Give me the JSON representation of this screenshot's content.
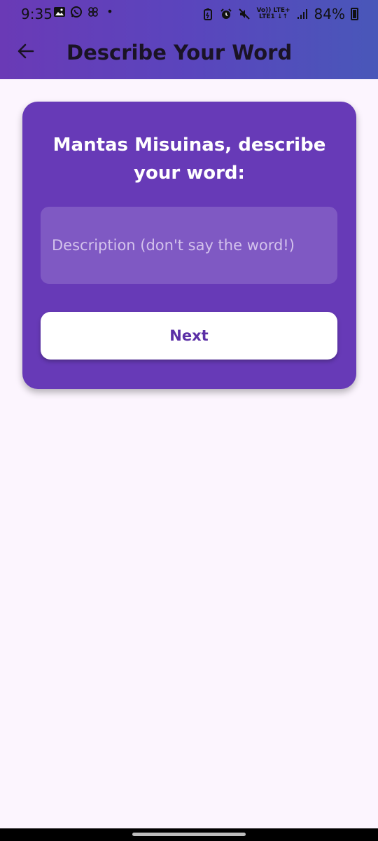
{
  "status_bar": {
    "time": "9:35",
    "dot": "•",
    "network_top": "Vo)) LTE+",
    "network_bottom": "LTE1 ↓↑",
    "battery_percent": "84%"
  },
  "app_bar": {
    "title": "Describe Your Word",
    "back_icon": "arrow-left-icon"
  },
  "card": {
    "prompt": "Mantas Misuinas, describe your word:",
    "description_input": {
      "value": "",
      "placeholder": "Description (don't say the word!)"
    },
    "next_label": "Next"
  },
  "colors": {
    "app_bar_gradient_start": "#6a3ab6",
    "app_bar_gradient_end": "#4957b9",
    "card_background": "#673ab7",
    "input_background": "#7f59c3",
    "page_background": "#fcf5fe",
    "button_text": "#5b2fa6"
  }
}
